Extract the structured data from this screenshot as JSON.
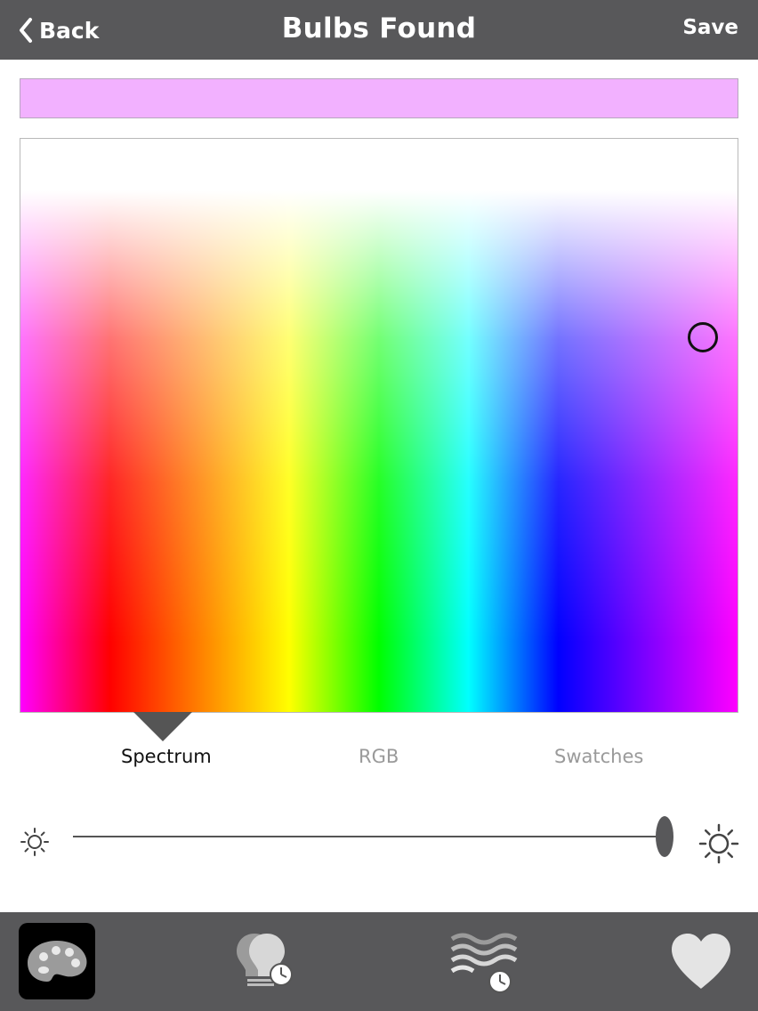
{
  "header": {
    "back_label": "Back",
    "title": "Bulbs Found",
    "save_label": "Save"
  },
  "selected_color": "#f2b1ff",
  "tabs": [
    {
      "label": "Spectrum",
      "active": true
    },
    {
      "label": "RGB",
      "active": false
    },
    {
      "label": "Swatches",
      "active": false
    }
  ],
  "brightness": {
    "level": 1.0
  },
  "bottom_nav": [
    {
      "icon": "palette-icon",
      "selected": true
    },
    {
      "icon": "bulbs-schedule-icon",
      "selected": false
    },
    {
      "icon": "waves-schedule-icon",
      "selected": false
    },
    {
      "icon": "heart-icon",
      "selected": false
    }
  ]
}
